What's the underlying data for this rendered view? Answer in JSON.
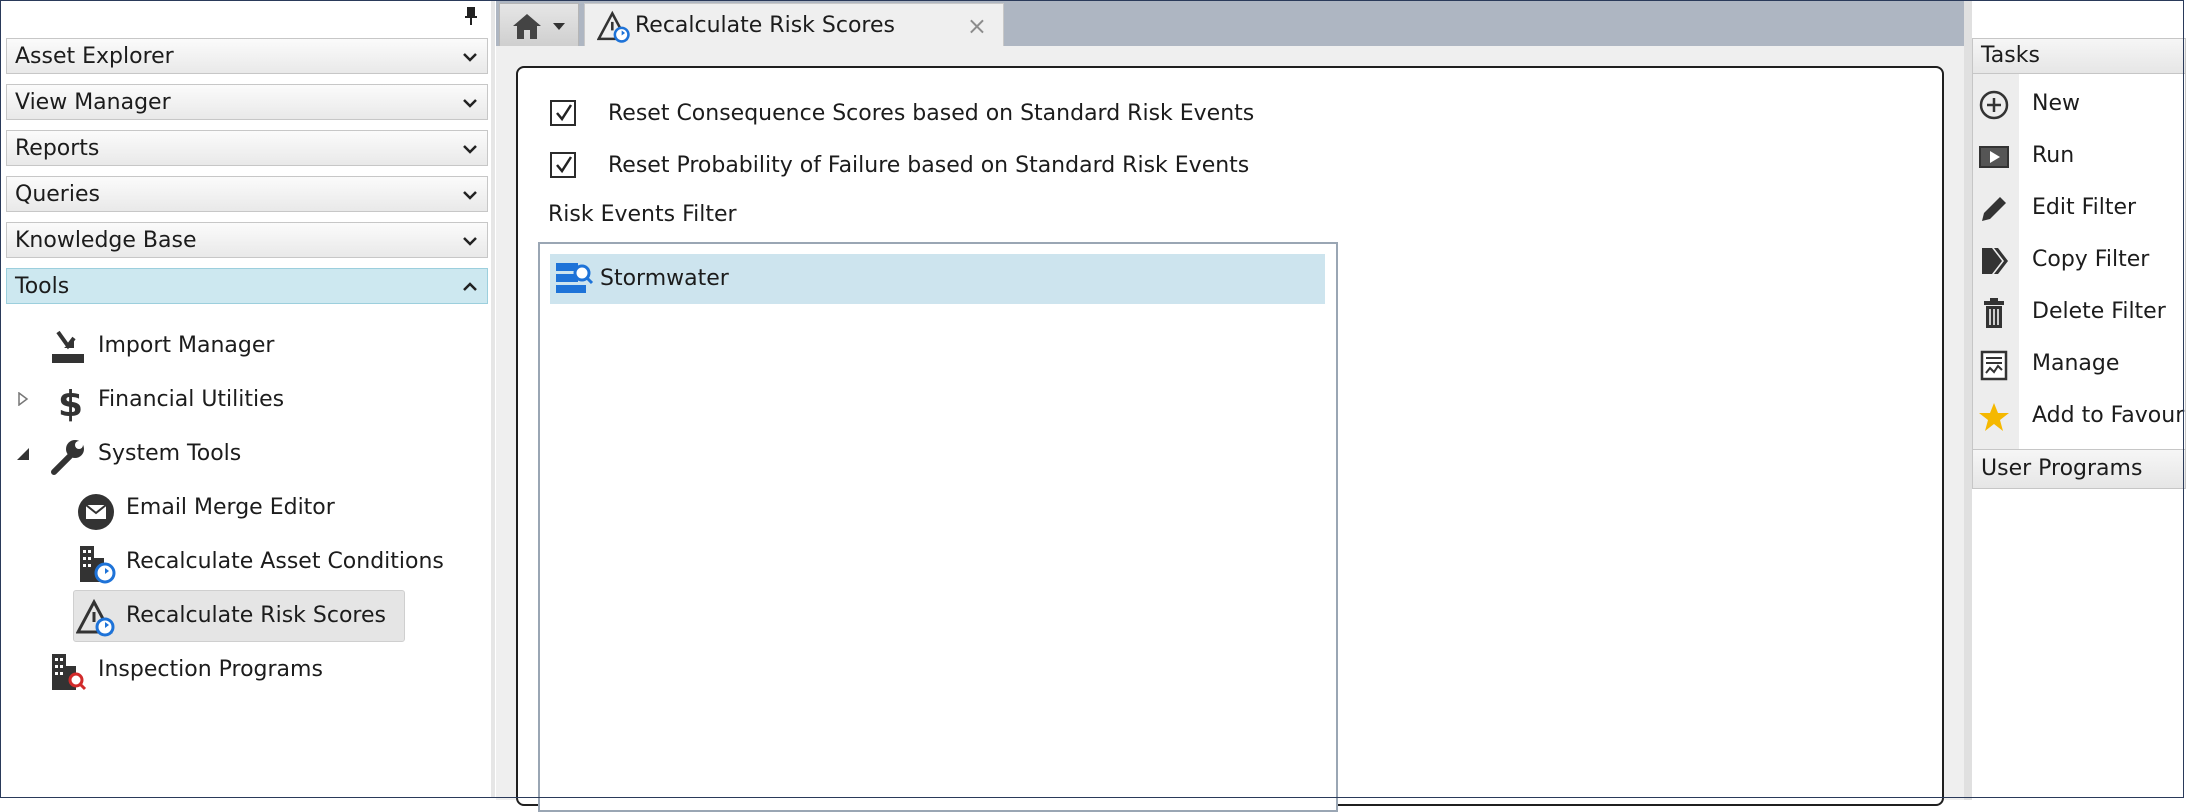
{
  "left_nav": {
    "accordion": [
      {
        "label": "Asset Explorer"
      },
      {
        "label": "View Manager"
      },
      {
        "label": "Reports"
      },
      {
        "label": "Queries"
      },
      {
        "label": "Knowledge Base"
      },
      {
        "label": "Tools"
      }
    ],
    "tree": [
      {
        "label": "Import Manager",
        "icon": "import-icon"
      },
      {
        "label": "Financial Utilities",
        "icon": "dollar-icon"
      },
      {
        "label": "System Tools",
        "icon": "wrench-icon"
      },
      {
        "label": "Email Merge Editor",
        "icon": "email-icon"
      },
      {
        "label": "Recalculate Asset Conditions",
        "icon": "building-refresh-icon"
      },
      {
        "label": "Recalculate Risk Scores",
        "icon": "risk-refresh-icon"
      },
      {
        "label": "Inspection Programs",
        "icon": "building-search-icon"
      }
    ]
  },
  "tab": {
    "title": "Recalculate Risk Scores",
    "close": "×"
  },
  "main": {
    "options": [
      {
        "label": "Reset Consequence Scores based on Standard Risk Events",
        "checked": true
      },
      {
        "label": "Reset Probability of Failure based on Standard Risk Events",
        "checked": true
      }
    ],
    "filter_label": "Risk Events Filter",
    "filter_items": [
      {
        "label": "Stormwater",
        "icon": "filter-server-icon"
      }
    ]
  },
  "tasks": {
    "header": "Tasks",
    "items": [
      {
        "label": "New",
        "icon": "plus-circle-icon"
      },
      {
        "label": "Run",
        "icon": "play-icon"
      },
      {
        "label": "Edit Filter",
        "icon": "pencil-icon"
      },
      {
        "label": "Copy Filter",
        "icon": "copy-icon"
      },
      {
        "label": "Delete Filter",
        "icon": "trash-icon"
      },
      {
        "label": "Manage",
        "icon": "manage-icon"
      },
      {
        "label": "Add to Favour",
        "icon": "star-icon"
      }
    ],
    "user_programs": "User Programs"
  },
  "colors": {
    "accent_active": "#cde8f0",
    "selection": "#cde4ee",
    "tabstrip": "#aeb6c2",
    "star": "#f5b800"
  }
}
